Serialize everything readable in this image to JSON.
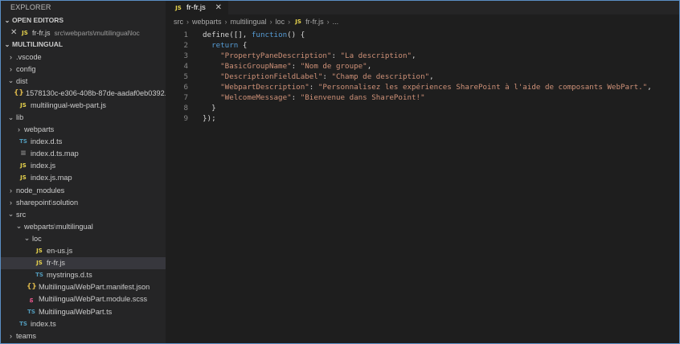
{
  "explorer": {
    "title": "EXPLORER",
    "open_editors": {
      "header": "OPEN EDITORS",
      "items": [
        {
          "name": "fr-fr.js",
          "path": "src\\webparts\\multilingual\\loc"
        }
      ]
    },
    "project": {
      "header": "MULTILINGUAL",
      "tree": [
        {
          "name": ".vscode",
          "kind": "folder-collapsed"
        },
        {
          "name": "config",
          "kind": "folder-collapsed"
        },
        {
          "name": "dist",
          "kind": "folder-expanded"
        },
        {
          "name": "1578130c-e306-408b-87de-aadaf0eb0392....",
          "kind": "json"
        },
        {
          "name": "multilingual-web-part.js",
          "kind": "js"
        },
        {
          "name": "lib",
          "kind": "folder-expanded"
        },
        {
          "name": "webparts",
          "kind": "folder-collapsed"
        },
        {
          "name": "index.d.ts",
          "kind": "ts"
        },
        {
          "name": "index.d.ts.map",
          "kind": "map"
        },
        {
          "name": "index.js",
          "kind": "js"
        },
        {
          "name": "index.js.map",
          "kind": "js"
        },
        {
          "name": "node_modules",
          "kind": "folder-collapsed"
        },
        {
          "name": "sharepoint",
          "name2": "solution",
          "kind": "folder-collapsed"
        },
        {
          "name": "src",
          "kind": "folder-expanded"
        },
        {
          "name": "webparts",
          "name2": "multilingual",
          "kind": "folder-expanded"
        },
        {
          "name": "loc",
          "kind": "folder-expanded"
        },
        {
          "name": "en-us.js",
          "kind": "js"
        },
        {
          "name": "fr-fr.js",
          "kind": "js"
        },
        {
          "name": "mystrings.d.ts",
          "kind": "ts"
        },
        {
          "name": "MultilingualWebPart.manifest.json",
          "kind": "json"
        },
        {
          "name": "MultilingualWebPart.module.scss",
          "kind": "scss"
        },
        {
          "name": "MultilingualWebPart.ts",
          "kind": "ts"
        },
        {
          "name": "index.ts",
          "kind": "ts"
        },
        {
          "name": "teams",
          "kind": "folder-collapsed"
        }
      ]
    }
  },
  "icons": {
    "js": "JS",
    "ts": "TS",
    "json": "{}",
    "map": "≡",
    "scss": "ꟙ"
  },
  "editor": {
    "tab": {
      "label": "fr-fr.js",
      "close": "✕"
    },
    "breadcrumb": [
      "src",
      "webparts",
      "multilingual",
      "loc",
      "fr-fr.js",
      "..."
    ],
    "line_numbers": [
      "1",
      "2",
      "3",
      "4",
      "5",
      "6",
      "7",
      "8",
      "9"
    ],
    "code": {
      "l1_kw1": "define",
      "l1_a": "([], ",
      "l1_kw2": "function",
      "l1_b": "() {",
      "l2_kw": "return",
      "l2_b": " {",
      "entries": [
        {
          "key": "\"PropertyPaneDescription\"",
          "value": "\"La description\""
        },
        {
          "key": "\"BasicGroupName\"",
          "value": "\"Nom de groupe\""
        },
        {
          "key": "\"DescriptionFieldLabel\"",
          "value": "\"Champ de description\""
        },
        {
          "key": "\"WebpartDescription\"",
          "value": "\"Personnalisez les expériences SharePoint à l'aide de composants WebPart.\""
        },
        {
          "key": "\"WelcomeMessage\"",
          "value": "\"Bienvenue dans SharePoint!\""
        }
      ],
      "l8": "}",
      "l9": "});"
    }
  }
}
